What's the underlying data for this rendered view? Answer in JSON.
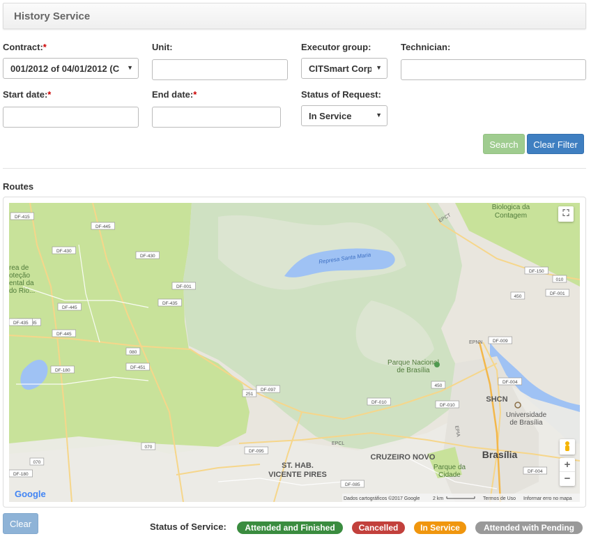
{
  "header": {
    "title": "History Service"
  },
  "filters": {
    "contract": {
      "label": "Contract:",
      "required": "*",
      "value": "001/2012 of 04/01/2012 (C"
    },
    "unit": {
      "label": "Unit:",
      "value": ""
    },
    "executor_group": {
      "label": "Executor group:",
      "value": "CITSmart Corp"
    },
    "technician": {
      "label": "Technician:",
      "value": ""
    },
    "start_date": {
      "label": "Start date:",
      "required": "*",
      "value": ""
    },
    "end_date": {
      "label": "End date:",
      "required": "*",
      "value": ""
    },
    "status_of_request": {
      "label": "Status of Request:",
      "value": "In Service"
    }
  },
  "buttons": {
    "search": "Search",
    "clear_filter": "Clear Filter",
    "clear": "Clear"
  },
  "routes": {
    "label": "Routes"
  },
  "map": {
    "lake": "Represa Santa Maria",
    "park": "Parque Nacional de Brasília",
    "places": {
      "biologica": [
        "Biologica da",
        "Contagem"
      ],
      "area_protecao": [
        "rea de",
        "oteção",
        "ental da",
        "do Rio..."
      ],
      "shcn": "SHCN",
      "universidade": [
        "Universidade",
        "de Brasília"
      ],
      "cruzeiro": "CRUZEIRO NOVO",
      "brasilia": "Brasília",
      "parque_cidade": [
        "Parque da",
        "Cidade"
      ],
      "vicente": [
        "ST. HAB.",
        "VICENTE PIRES"
      ],
      "epct": "EPCT",
      "epcl": "EPCL",
      "epia": "EPIA",
      "epnn": "EPNN"
    },
    "roads": [
      "DF-415",
      "DF-445",
      "DF-430",
      "DF-430",
      "DF-001",
      "DF-435",
      "DF-445",
      "DF-435",
      "DF-435",
      "DF-445",
      "080",
      "DF-180",
      "DF-451",
      "251",
      "DF-097",
      "DF-010",
      "450",
      "DF-009",
      "DF-004",
      "DF-150",
      "010",
      "DF-001",
      "450",
      "DF-010",
      "DF-095",
      "070",
      "070",
      "DF-180",
      "DF-085",
      "DF-004"
    ],
    "footer": {
      "google": "Google",
      "data": "Dados cartográficos ©2017 Google",
      "scale": "2 km",
      "terms": "Termos de Uso",
      "report": "Informar erro no mapa"
    },
    "zoom_in": "+",
    "zoom_out": "−"
  },
  "status_legend": {
    "label": "Status of Service:",
    "items": [
      {
        "label": "Attended and Finished",
        "color": "#3a8c3f"
      },
      {
        "label": "Cancelled",
        "color": "#c2403c"
      },
      {
        "label": "In Service",
        "color": "#f0960e"
      },
      {
        "label": "Attended with Pending",
        "color": "#999999"
      }
    ]
  }
}
